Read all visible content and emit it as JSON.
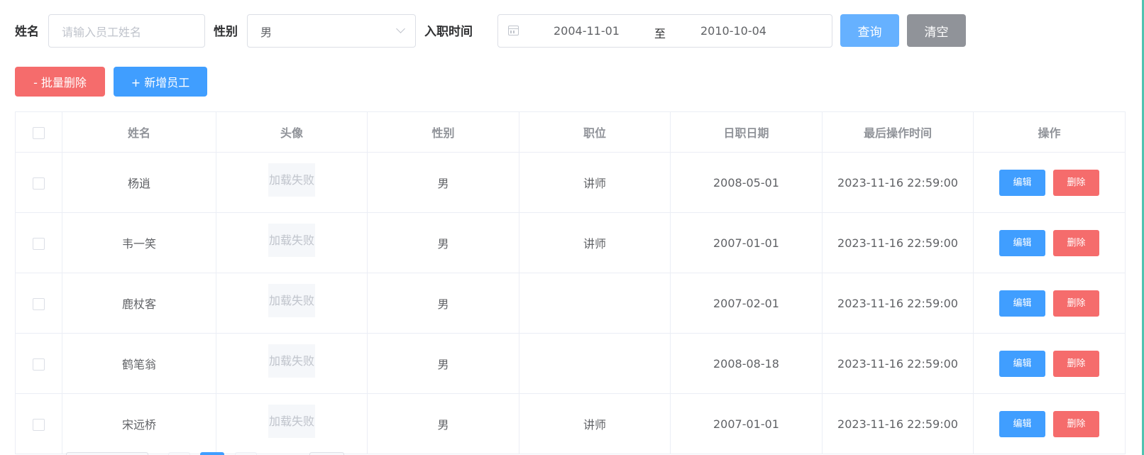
{
  "filter": {
    "name_label": "姓名",
    "name_placeholder": "请输入员工姓名",
    "gender_label": "性别",
    "gender_value": "男",
    "date_label": "入职时间",
    "date_start": "2004-11-01",
    "date_sep": "至",
    "date_end": "2010-10-04",
    "query_btn": "查询",
    "clear_btn": "清空"
  },
  "actions": {
    "batch_delete": "- 批量删除",
    "add_employee": "+ 新增员工"
  },
  "colors": {
    "primary": "#409eff",
    "primary_light": "#66b1ff",
    "danger": "#f56c6c",
    "info": "#909399"
  },
  "table": {
    "headers": [
      "姓名",
      "头像",
      "性别",
      "职位",
      "日职日期",
      "最后操作时间",
      "操作"
    ],
    "rows": [
      {
        "name": "杨逍",
        "avatar": "加载失败",
        "gender": "男",
        "job": "讲师",
        "entry": "2008-05-01",
        "updated": "2023-11-16 22:59:00"
      },
      {
        "name": "韦一笑",
        "avatar": "加载失败",
        "gender": "男",
        "job": "讲师",
        "entry": "2007-01-01",
        "updated": "2023-11-16 22:59:00"
      },
      {
        "name": "鹿杖客",
        "avatar": "加载失败",
        "gender": "男",
        "job": "",
        "entry": "2007-02-01",
        "updated": "2023-11-16 22:59:00"
      },
      {
        "name": "鹤笔翁",
        "avatar": "加载失败",
        "gender": "男",
        "job": "",
        "entry": "2008-08-18",
        "updated": "2023-11-16 22:59:00"
      },
      {
        "name": "宋远桥",
        "avatar": "加载失败",
        "gender": "男",
        "job": "讲师",
        "entry": "2007-01-01",
        "updated": "2023-11-16 22:59:00"
      }
    ],
    "edit_label": "编辑",
    "delete_label": "删除"
  }
}
